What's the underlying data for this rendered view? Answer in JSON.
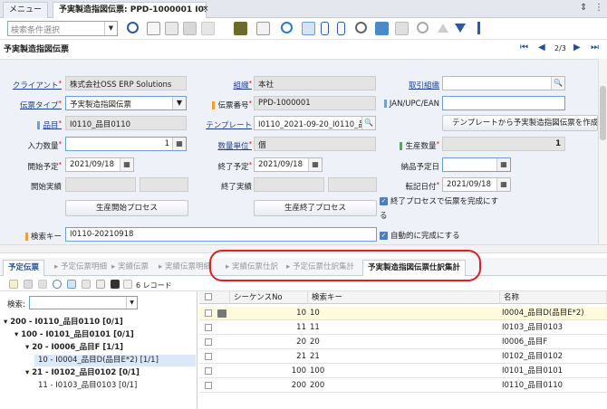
{
  "tabs": {
    "menu": "メニュー",
    "active": "予実製造指図伝票: PPD-1000001 I011...",
    "close": "×"
  },
  "toolbar": {
    "search_placeholder": "検索条件選択"
  },
  "window": {
    "title": "予実製造指図伝票",
    "record_nav": "2/3"
  },
  "form": {
    "client_label": "クライアント",
    "client_value": "株式会社OSS ERP Solutions",
    "org_label": "組織",
    "org_value": "本社",
    "trade_org_label": "取引組織",
    "doctype_label": "伝票タイプ",
    "doctype_value": "予実製造指図伝票",
    "docno_label": "伝票番号",
    "docno_value": "PPD-1000001",
    "jan_label": "JAN/UPC/EAN",
    "product_label": "品目",
    "product_value": "I0110_品目0110",
    "template_label": "テンプレート",
    "template_value": "I0110_2021-09-20_I0110_品目",
    "template_btn": "テンプレートから予実製造指図伝票を作成",
    "qty_label": "入力数量",
    "qty_value": "1",
    "uom_label": "数量単位",
    "uom_value": "個",
    "prodqty_label": "生産数量",
    "prodqty_value": "1",
    "start_plan_label": "開始予定",
    "start_plan_value": "2021/09/18",
    "end_plan_label": "終了予定",
    "end_plan_value": "2021/09/18",
    "delivery_plan_label": "納品予定日",
    "start_actual_label": "開始実績",
    "end_actual_label": "終了実績",
    "posting_label": "転記日付",
    "posting_value": "2021/09/18",
    "start_btn": "生産開始プロセス",
    "end_btn": "生産終了プロセス",
    "complete_on_end_line1": "終了プロセスで伝票を完成にす",
    "complete_on_end_line2": "る",
    "search_key_label": "検索キー",
    "search_key_value": "I0110-20210918",
    "auto_complete_label": "自動的に完成にする"
  },
  "subtabs": [
    {
      "label": "予定伝票"
    },
    {
      "label": "予定伝票明細"
    },
    {
      "label": "実績伝票"
    },
    {
      "label": "実績伝票明細"
    },
    {
      "label": "実績伝票仕訳"
    },
    {
      "label": "予定伝票仕訳集計"
    },
    {
      "label": "予実製造指図伝票仕訳集計"
    }
  ],
  "subtoolbar": {
    "record_count": "6 レコード"
  },
  "tree": {
    "keyword_label": "検索:",
    "items": [
      {
        "text": "200 - I0110_品目0110 [0/1]"
      },
      {
        "text": "100 - I0101_品目0101 [0/1]"
      },
      {
        "text": "20 - I0006_品目F [1/1]"
      },
      {
        "text": "10 - I0004_品目D(品目E*2) [1/1]"
      },
      {
        "text": "21 - I0102_品目0102 [0/1]"
      },
      {
        "text": "11 - I0103_品目0103 [0/1]"
      }
    ]
  },
  "grid": {
    "headers": {
      "seq": "シーケンスNo",
      "key": "検索キー",
      "name": "名称"
    },
    "rows": [
      {
        "seq": "10",
        "key": "10",
        "name": "I0004_品目D(品目E*2)"
      },
      {
        "seq": "11",
        "key": "11",
        "name": "I0103_品目0103"
      },
      {
        "seq": "20",
        "key": "20",
        "name": "I0006_品目F"
      },
      {
        "seq": "21",
        "key": "21",
        "name": "I0102_品目0102"
      },
      {
        "seq": "100",
        "key": "100",
        "name": "I0101_品目0101"
      },
      {
        "seq": "200",
        "key": "200",
        "name": "I0110_品目0110"
      }
    ]
  },
  "colors": {
    "accent": "#1f4fa0",
    "highlight": "#e02020",
    "selected_row": "#fdfbdc"
  }
}
